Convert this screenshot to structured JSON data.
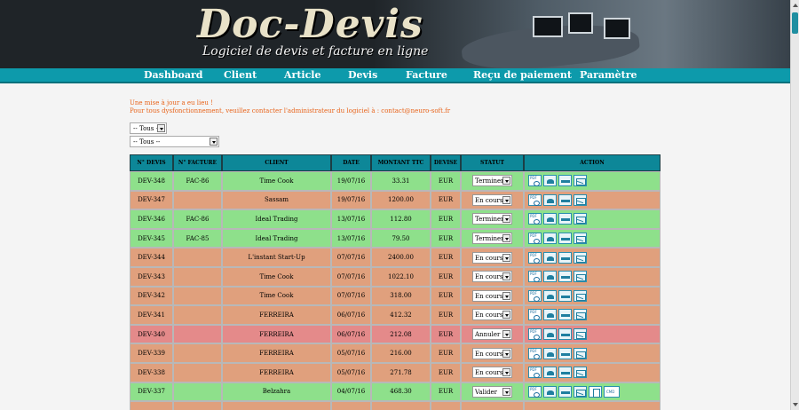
{
  "header": {
    "logo_title": "Doc-Devis",
    "logo_subtitle": "Logiciel de devis et facture en ligne"
  },
  "nav": [
    {
      "label": "Dashboard"
    },
    {
      "label": "Client"
    },
    {
      "label": "Article"
    },
    {
      "label": "Devis"
    },
    {
      "label": "Facture"
    },
    {
      "label": "Reçu de paiement"
    },
    {
      "label": "Paramètre"
    }
  ],
  "messages": {
    "update": "Une mise à jour a eu lieu !",
    "contact": "Pour tous dysfonctionnement, veuillez contacter l'administrateur du logiciel à : contact@neuro-soft.fr"
  },
  "filters": {
    "filter1": "-- Tous --",
    "filter2": "-- Tous --"
  },
  "table": {
    "headers": [
      "N° DEVIS",
      "N° FACTURE",
      "CLIENT",
      "DATE",
      "MONTANT TTC",
      "DEVISE",
      "STATUT",
      "ACTION"
    ],
    "rows": [
      {
        "devis": "DEV-348",
        "facture": "FAC-86",
        "client": "Time Cook",
        "date": "19/07/16",
        "montant": "33.31",
        "devise": "EUR",
        "statut": "Terminer",
        "status_color": "green"
      },
      {
        "devis": "DEV-347",
        "facture": "",
        "client": "Sassam",
        "date": "19/07/16",
        "montant": "1200.00",
        "devise": "EUR",
        "statut": "En cours",
        "status_color": "orange"
      },
      {
        "devis": "DEV-346",
        "facture": "FAC-86",
        "client": "Ideal Trading",
        "date": "13/07/16",
        "montant": "112.80",
        "devise": "EUR",
        "statut": "Terminer",
        "status_color": "green"
      },
      {
        "devis": "DEV-345",
        "facture": "FAC-85",
        "client": "Ideal Trading",
        "date": "13/07/16",
        "montant": "79.50",
        "devise": "EUR",
        "statut": "Terminer",
        "status_color": "green"
      },
      {
        "devis": "DEV-344",
        "facture": "",
        "client": "L'instant Start-Up",
        "date": "07/07/16",
        "montant": "2400.00",
        "devise": "EUR",
        "statut": "En cours",
        "status_color": "orange"
      },
      {
        "devis": "DEV-343",
        "facture": "",
        "client": "Time Cook",
        "date": "07/07/16",
        "montant": "1022.10",
        "devise": "EUR",
        "statut": "En cours",
        "status_color": "orange"
      },
      {
        "devis": "DEV-342",
        "facture": "",
        "client": "Time Cook",
        "date": "07/07/16",
        "montant": "318.00",
        "devise": "EUR",
        "statut": "En cours",
        "status_color": "orange"
      },
      {
        "devis": "DEV-341",
        "facture": "",
        "client": "FERREIRA",
        "date": "06/07/16",
        "montant": "412.32",
        "devise": "EUR",
        "statut": "En cours",
        "status_color": "orange"
      },
      {
        "devis": "DEV-340",
        "facture": "",
        "client": "FERREIRA",
        "date": "06/07/16",
        "montant": "212.08",
        "devise": "EUR",
        "statut": "Annuler",
        "status_color": "red"
      },
      {
        "devis": "DEV-339",
        "facture": "",
        "client": "FERREIRA",
        "date": "05/07/16",
        "montant": "216.00",
        "devise": "EUR",
        "statut": "En cours",
        "status_color": "orange"
      },
      {
        "devis": "DEV-338",
        "facture": "",
        "client": "FERREIRA",
        "date": "05/07/16",
        "montant": "271.78",
        "devise": "EUR",
        "statut": "En cours",
        "status_color": "orange"
      },
      {
        "devis": "DEV-337",
        "facture": "",
        "client": "Belzahra",
        "date": "04/07/16",
        "montant": "468.30",
        "devise": "EUR",
        "statut": "Valider",
        "status_color": "green"
      }
    ]
  },
  "colors": {
    "nav": "#0d9aab",
    "header_bg": "#1f2428",
    "message": "#e8641b",
    "row_green": "#8ee08b",
    "row_orange": "#e0a07d",
    "row_red": "#e48a8a"
  }
}
